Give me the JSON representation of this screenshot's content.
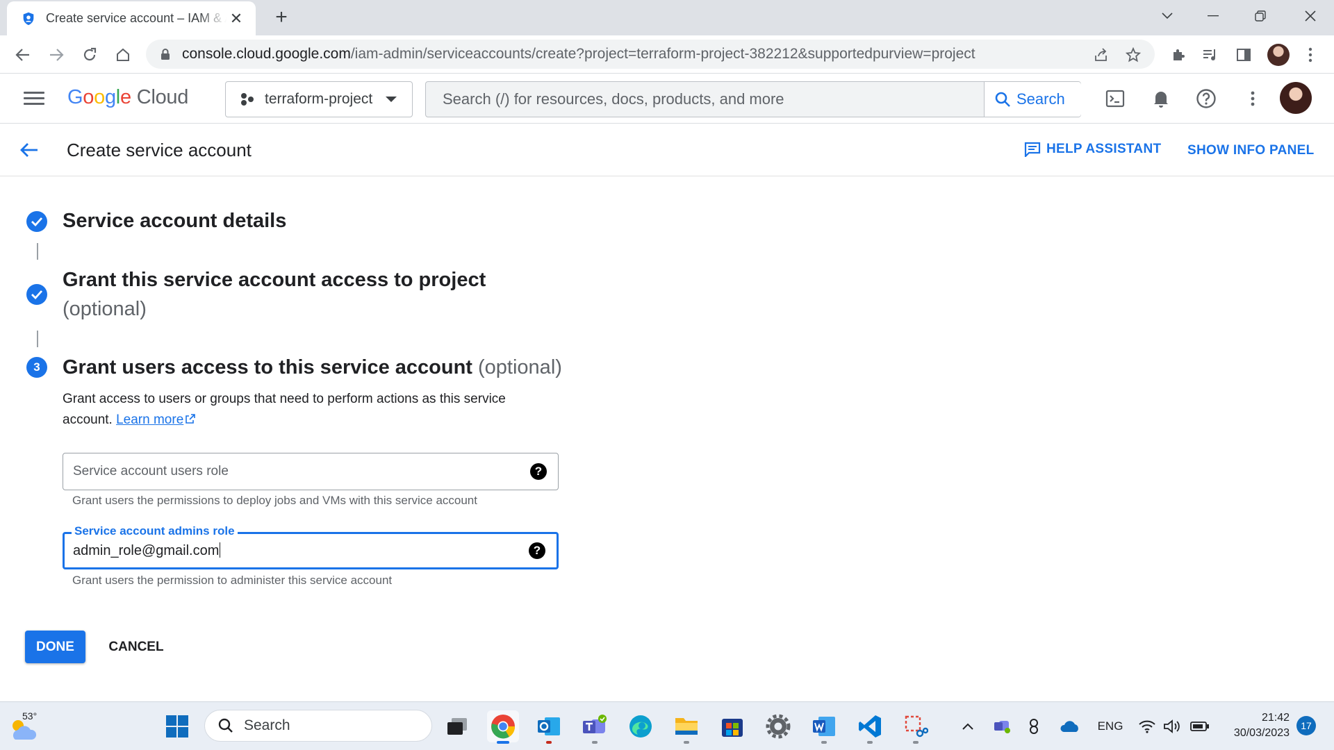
{
  "browser": {
    "tab_title": "Create service account – IAM & Admin",
    "new_tab": "+",
    "url_host": "console.cloud.google.com",
    "url_path": "/iam-admin/serviceaccounts/create?project=terraform-project-382212&supportedpurview=project"
  },
  "gcp": {
    "logo_google": [
      "G",
      "o",
      "o",
      "g",
      "l",
      "e"
    ],
    "logo_cloud": "Cloud",
    "project_name": "terraform-project",
    "search_placeholder": "Search (/) for resources, docs, products, and more",
    "search_button": "Search"
  },
  "page": {
    "title": "Create service account",
    "help_assistant": "HELP ASSISTANT",
    "show_info_panel": "SHOW INFO PANEL"
  },
  "steps": [
    {
      "title": "Service account details",
      "optional": "",
      "status": "done"
    },
    {
      "title": "Grant this service account access to project",
      "optional": "(optional)",
      "status": "done"
    },
    {
      "number": "3",
      "title": "Grant users access to this service account",
      "optional": "(optional)",
      "status": "active",
      "description": "Grant access to users or groups that need to perform actions as this service account.",
      "learn_more": "Learn more"
    }
  ],
  "fields": {
    "users_role": {
      "placeholder": "Service account users role",
      "value": "",
      "hint": "Grant users the permissions to deploy jobs and VMs with this service account"
    },
    "admins_role": {
      "label": "Service account admins role",
      "value": "admin_role@gmail.com",
      "hint": "Grant users the permission to administer this service account"
    }
  },
  "buttons": {
    "done": "DONE",
    "cancel": "CANCEL"
  },
  "taskbar": {
    "weather_temp": "53°",
    "search_label": "Search",
    "language": "ENG",
    "time": "21:42",
    "date": "30/03/2023",
    "notification_count": "17"
  },
  "colors": {
    "accent": "#1a73e8",
    "text": "#202124",
    "muted": "#5f6368"
  }
}
